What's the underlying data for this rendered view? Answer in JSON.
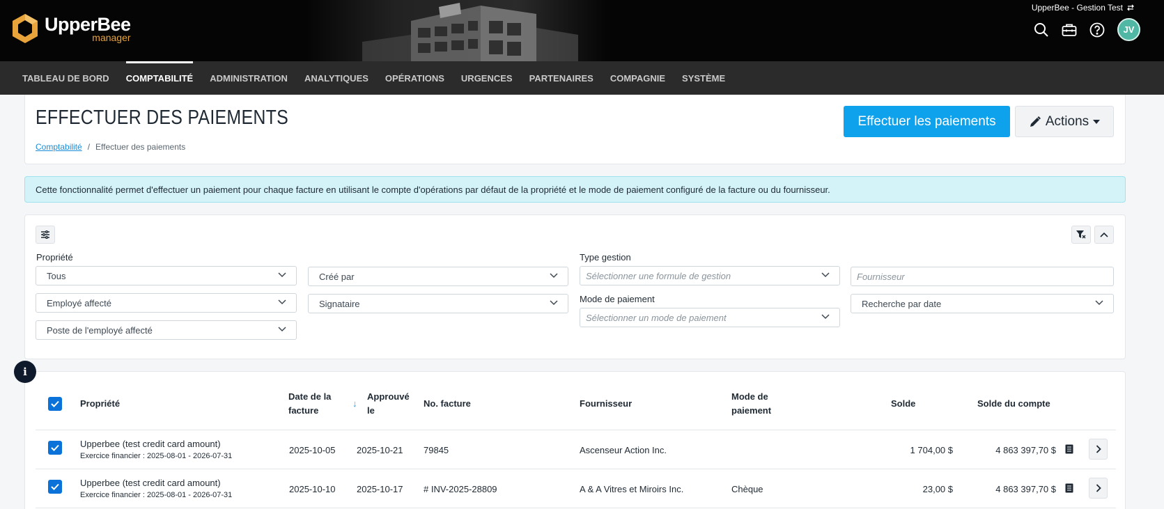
{
  "header": {
    "logo_main": "UpperBee",
    "logo_sub": "manager",
    "environment": "UpperBee - Gestion Test",
    "icons": [
      "search-icon",
      "toolbox-icon",
      "help-icon"
    ],
    "user_initials": "JV"
  },
  "nav": {
    "items": [
      {
        "label": "TABLEAU DE BORD",
        "active": false
      },
      {
        "label": "COMPTABILITÉ",
        "active": true
      },
      {
        "label": "ADMINISTRATION",
        "active": false
      },
      {
        "label": "ANALYTIQUES",
        "active": false
      },
      {
        "label": "OPÉRATIONS",
        "active": false
      },
      {
        "label": "URGENCES",
        "active": false
      },
      {
        "label": "PARTENAIRES",
        "active": false
      },
      {
        "label": "COMPAGNIE",
        "active": false
      },
      {
        "label": "SYSTÈME",
        "active": false
      }
    ]
  },
  "page": {
    "title": "EFFECTUER DES PAIEMENTS",
    "breadcrumb": {
      "parent": "Comptabilité",
      "separator": "/",
      "current": "Effectuer des paiements"
    },
    "primary_button": "Effectuer les paiements",
    "actions_button": "Actions"
  },
  "alert": {
    "text": "Cette fonctionnalité permet d'effectuer un paiement pour chaque facture en utilisant le compte d'opérations par défaut de la propriété et le mode de paiement configuré de la facture ou du fournisseur."
  },
  "filters": {
    "propriete_label": "Propriété",
    "propriete_value": "Tous",
    "cree_par": "Créé par",
    "type_gestion_label": "Type gestion",
    "type_gestion_placeholder": "Sélectionner une formule de gestion",
    "fournisseur_placeholder": "Fournisseur",
    "employe_affecte": "Employé affecté",
    "signataire": "Signataire",
    "mode_paiement_label": "Mode de paiement",
    "mode_paiement_placeholder": "Sélectionner un mode de paiement",
    "recherche_date": "Recherche par date",
    "poste_employe": "Poste de l'employé affecté"
  },
  "table": {
    "headers": {
      "propriete": "Propriété",
      "date_facture_1": "Date de la",
      "date_facture_2": "facture",
      "approuve_1": "Approuvé",
      "approuve_2": "le",
      "no_facture": "No. facture",
      "fournisseur": "Fournisseur",
      "mode_1": "Mode de",
      "mode_2": "paiement",
      "solde": "Solde",
      "solde_compte": "Solde du compte"
    },
    "sort_indicator": "↓",
    "rows": [
      {
        "propriete": "Upperbee (test credit card amount)",
        "exercice": "Exercice financier : 2025-08-01 - 2026-07-31",
        "date_facture": "2025-10-05",
        "approuve": "2025-10-21",
        "no_facture": "79845",
        "fournisseur": "Ascenseur Action Inc.",
        "mode": "",
        "solde": "1 704,00 $",
        "solde_compte": "4 863 397,70 $",
        "checked": true
      },
      {
        "propriete": "Upperbee (test credit card amount)",
        "exercice": "Exercice financier : 2025-08-01 - 2026-07-31",
        "date_facture": "2025-10-10",
        "approuve": "2025-10-17",
        "no_facture": "# INV-2025-28809",
        "fournisseur": "A & A Vitres et Miroirs Inc.",
        "mode": "Chèque",
        "solde": "23,00 $",
        "solde_compte": "4 863 397,70 $",
        "checked": true
      }
    ]
  },
  "colors": {
    "primary": "#0ea1ec",
    "checkbox": "#0a72d8",
    "logo_accent": "#e8a33a",
    "avatar": "#4fb7a3",
    "alert_bg": "#d3f3f8"
  }
}
